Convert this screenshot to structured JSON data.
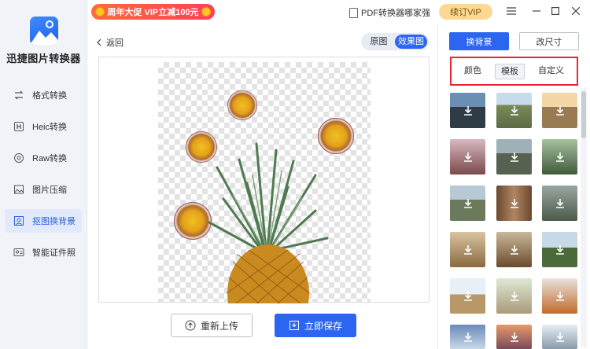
{
  "app": {
    "name": "迅捷图片转换器"
  },
  "sidebar": {
    "items": [
      {
        "label": "格式转换",
        "icon": "format-convert-icon"
      },
      {
        "label": "Heic转换",
        "icon": "heic-icon"
      },
      {
        "label": "Raw转换",
        "icon": "raw-icon"
      },
      {
        "label": "图片压缩",
        "icon": "image-compress-icon"
      },
      {
        "label": "抠图换背景",
        "icon": "cutout-icon"
      },
      {
        "label": "智能证件照",
        "icon": "id-photo-icon"
      }
    ],
    "active_index": 4
  },
  "titlebar": {
    "promo": "周年大促 VIP立减100元",
    "pdf_link": "PDF转换器哪家强",
    "vip_button": "续订VIP"
  },
  "main": {
    "back_label": "返回",
    "view_toggle": [
      "原图",
      "效果图"
    ],
    "view_toggle_active": 1,
    "reupload_label": "重新上传",
    "save_label": "立即保存"
  },
  "right_panel": {
    "tabs": [
      "换背景",
      "改尺寸"
    ],
    "tabs_active": 0,
    "subtabs": [
      "颜色",
      "模板",
      "自定义"
    ],
    "subtabs_active": 1,
    "templates": [
      "road-template",
      "highway-template",
      "desert-road-template",
      "cherry-blossom-template",
      "mountain-road-template",
      "forest-road-template",
      "valley-road-template",
      "tree-trunk-template",
      "deer-template",
      "lion-template",
      "yak-template",
      "horse-template",
      "camel-template",
      "cheetah-template",
      "fox-template",
      "sky-template",
      "sunset-template",
      "snow-mountain-template"
    ]
  },
  "colors": {
    "accent": "#2b65f0",
    "highlight_border": "#e8262b",
    "vip": "#fcd993"
  }
}
